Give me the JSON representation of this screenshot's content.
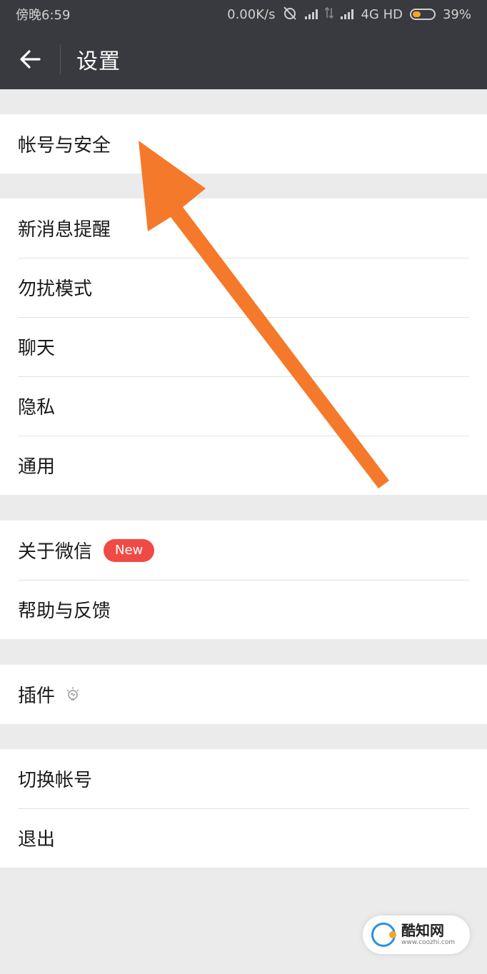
{
  "status_bar": {
    "time": "傍晚6:59",
    "speed": "0.00K/s",
    "network": "4G HD",
    "battery": "39%",
    "battery_level": 0.39
  },
  "header": {
    "title": "设置",
    "back_icon": "arrow-left-icon"
  },
  "settings": {
    "account_security": "帐号与安全",
    "notifications": "新消息提醒",
    "do_not_disturb": "勿扰模式",
    "chat": "聊天",
    "privacy": "隐私",
    "general": "通用",
    "about": "关于微信",
    "about_badge": "New",
    "help_feedback": "帮助与反馈",
    "plugins": "插件",
    "switch_account": "切换帐号",
    "logout": "退出"
  },
  "watermark": {
    "brand": "酷知网",
    "url": "www.coozhi.com"
  },
  "colors": {
    "header_bg": "#393a3f",
    "background": "#ebebeb",
    "badge": "#f04a45",
    "arrow": "#f5792a"
  }
}
